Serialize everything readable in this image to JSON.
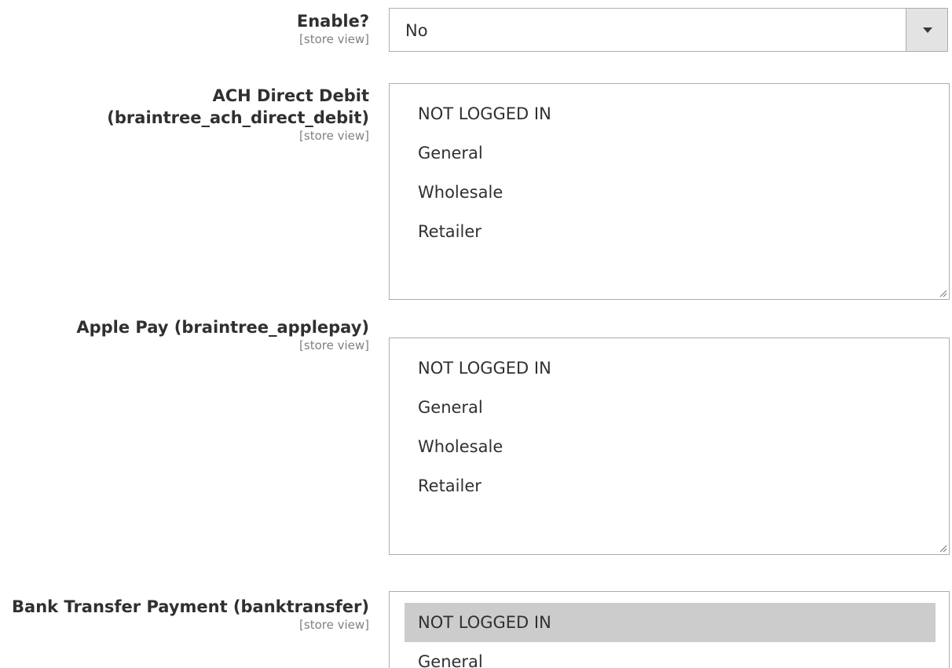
{
  "fields": {
    "enable": {
      "label": "Enable?",
      "scope": "[store view]",
      "value": "No"
    },
    "ach": {
      "label_line1": "ACH Direct Debit",
      "label_line2": "(braintree_ach_direct_debit)",
      "scope": "[store view]",
      "options": [
        "NOT LOGGED IN",
        "General",
        "Wholesale",
        "Retailer"
      ]
    },
    "applepay": {
      "label": "Apple Pay (braintree_applepay)",
      "scope": "[store view]",
      "options": [
        "NOT LOGGED IN",
        "General",
        "Wholesale",
        "Retailer"
      ]
    },
    "banktransfer": {
      "label": "Bank Transfer Payment (banktransfer)",
      "scope": "[store view]",
      "options": [
        "NOT LOGGED IN",
        "General"
      ],
      "selected": "NOT LOGGED IN"
    }
  },
  "colors": {
    "border": "#adadad",
    "arrow_bg": "#e3e3e3",
    "selected_option_bg": "#cccccc",
    "scope_text": "#808080"
  },
  "icons": {
    "dropdown": "chevron-down-icon",
    "resize": "resize-grip-icon"
  }
}
